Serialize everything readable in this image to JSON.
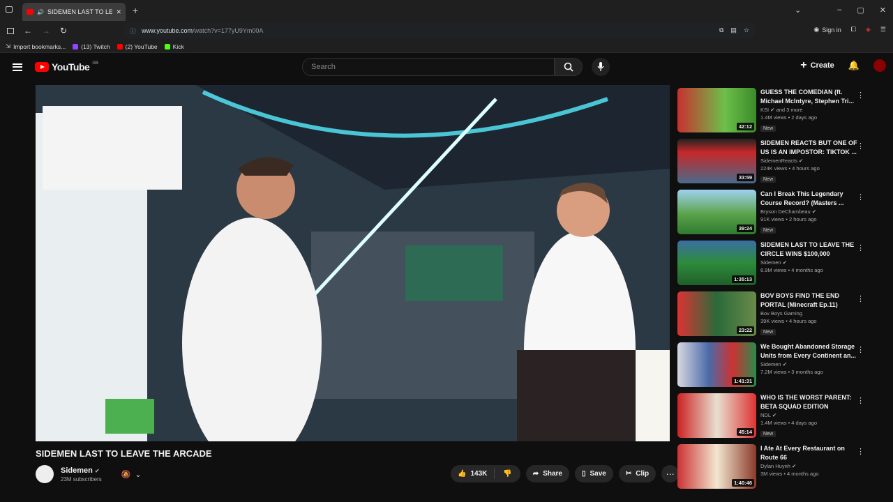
{
  "browser": {
    "tab_title": "SIDEMEN LAST TO LEAVE TH",
    "url_host": "www.youtube.com",
    "url_path": "/watch?v=177yU9Ym00A",
    "sign_in": "Sign in",
    "bookmarks": [
      "Import bookmarks...",
      "(13) Twitch",
      "(2) YouTube",
      "Kick"
    ]
  },
  "header": {
    "logo_text": "YouTube",
    "country": "GB",
    "search_placeholder": "Search",
    "create_label": "Create"
  },
  "video": {
    "title": "SIDEMEN LAST TO LEAVE THE ARCADE",
    "channel": "Sidemen",
    "subscribers": "23M subscribers",
    "likes": "143K",
    "share": "Share",
    "save": "Save",
    "clip": "Clip"
  },
  "recommendations": [
    {
      "title": "GUESS THE COMEDIAN (ft. Michael McIntyre, Stephen Tri...",
      "channel": "KSI",
      "extra": "and 3 more",
      "meta": "1.4M views • 2 days ago",
      "duration": "42:12",
      "new": "New"
    },
    {
      "title": "SIDEMEN REACTS BUT ONE OF US IS AN IMPOSTOR: TIKTOK ...",
      "channel": "SidemenReacts",
      "meta": "224K views • 4 hours ago",
      "duration": "33:59",
      "new": "New"
    },
    {
      "title": "Can I Break This Legendary Course Record? (Masters ...",
      "channel": "Bryson DeChambeau",
      "meta": "91K views • 2 hours ago",
      "duration": "39:24",
      "new": "New"
    },
    {
      "title": "SIDEMEN LAST TO LEAVE THE CIRCLE WINS $100,000",
      "channel": "Sidemen",
      "meta": "6.9M views • 4 months ago",
      "duration": "1:35:13"
    },
    {
      "title": "BOV BOYS FIND THE END PORTAL (Minecraft Ep.11)",
      "channel": "Bov Boys Gaming",
      "meta": "39K views • 4 hours ago",
      "duration": "23:22",
      "new": "New"
    },
    {
      "title": "We Bought Abandoned Storage Units from Every Continent an...",
      "channel": "Sidemen",
      "meta": "7.2M views • 3 months ago",
      "duration": "1:41:31"
    },
    {
      "title": "WHO IS THE WORST PARENT: BETA SQUAD EDITION",
      "channel": "NDL",
      "meta": "1.4M views • 4 days ago",
      "duration": "45:14",
      "new": "New"
    },
    {
      "title": "I Ate At Every Restaurant on Route 66",
      "channel": "Dylan Huynh",
      "meta": "3M views • 4 months ago",
      "duration": "1:40:46"
    }
  ],
  "colors": {
    "brand": "#ff0000",
    "background": "#0f0f0f"
  }
}
